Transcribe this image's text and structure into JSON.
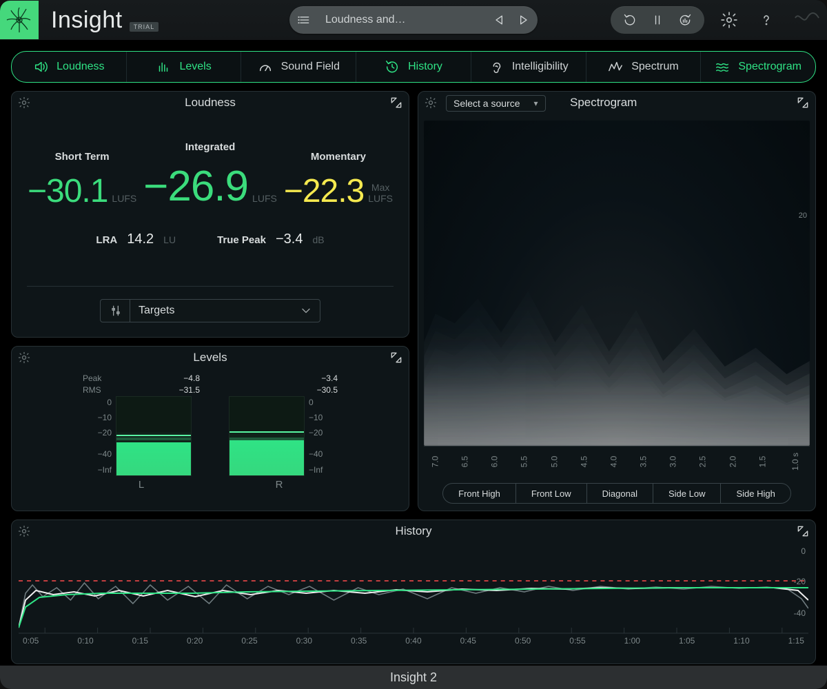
{
  "app": {
    "title": "Insight",
    "trial_badge": "TRIAL",
    "footer": "Insight 2"
  },
  "topbar": {
    "preset_name": "Loudness and…",
    "icons": {
      "menu": "menu-icon",
      "prev": "prev-icon",
      "next": "next-icon",
      "loop": "loop-icon",
      "pause": "pause-icon",
      "reset": "reset-stats-icon",
      "settings": "gear-icon",
      "help": "help-icon"
    }
  },
  "tabs": [
    {
      "id": "loudness",
      "label": "Loudness",
      "active": true
    },
    {
      "id": "levels",
      "label": "Levels",
      "active": true
    },
    {
      "id": "soundfield",
      "label": "Sound Field",
      "active": false
    },
    {
      "id": "history",
      "label": "History",
      "active": true
    },
    {
      "id": "intelligibility",
      "label": "Intelligibility",
      "active": false
    },
    {
      "id": "spectrum",
      "label": "Spectrum",
      "active": false
    },
    {
      "id": "spectrogram",
      "label": "Spectrogram",
      "active": true
    }
  ],
  "loudness": {
    "title": "Loudness",
    "short_term": {
      "label": "Short Term",
      "value": "−30.1",
      "unit": "LUFS"
    },
    "integrated": {
      "label": "Integrated",
      "value": "−26.9",
      "unit": "LUFS"
    },
    "momentary": {
      "label": "Momentary",
      "value": "−22.3",
      "unit_top": "Max",
      "unit": "LUFS"
    },
    "lra": {
      "label": "LRA",
      "value": "14.2",
      "unit": "LU"
    },
    "true_peak": {
      "label": "True Peak",
      "value": "−3.4",
      "unit": "dB"
    },
    "targets_label": "Targets"
  },
  "levels": {
    "title": "Levels",
    "headers": {
      "peak": "Peak",
      "rms": "RMS"
    },
    "scale": [
      "0",
      "−10",
      "−20",
      "",
      "−40",
      "−Inf"
    ],
    "channels": [
      {
        "name": "L",
        "peak": "−4.8",
        "rms": "−31.5",
        "fill_pct": 42,
        "rms_pct": 44,
        "peak_pct": 50
      },
      {
        "name": "R",
        "peak": "−3.4",
        "rms": "−30.5",
        "fill_pct": 44,
        "rms_pct": 44,
        "peak_pct": 54
      }
    ]
  },
  "spectrogram": {
    "title": "Spectrogram",
    "source_label": "Select a source",
    "freq_labels": [
      "20"
    ],
    "time_ticks": [
      "7.0",
      "6.5",
      "6.0",
      "5.5",
      "5.0",
      "4.5",
      "4.0",
      "3.5",
      "3.0",
      "2.5",
      "2.0",
      "1.5",
      "1.0"
    ],
    "views": [
      "Front High",
      "Front Low",
      "Diagonal",
      "Side Low",
      "Side High"
    ]
  },
  "history": {
    "title": "History",
    "y_labels": [
      "0",
      "-20",
      "-40"
    ],
    "time_ticks": [
      "0:05",
      "0:10",
      "0:15",
      "0:20",
      "0:25",
      "0:30",
      "0:35",
      "0:40",
      "0:45",
      "0:50",
      "0:55",
      "1:00",
      "1:05",
      "1:10",
      "1:15"
    ],
    "target_line_db": -23
  },
  "colors": {
    "accent": "#2fe385",
    "yellow": "#f5e94f",
    "logo_bg": "#45d87c"
  }
}
